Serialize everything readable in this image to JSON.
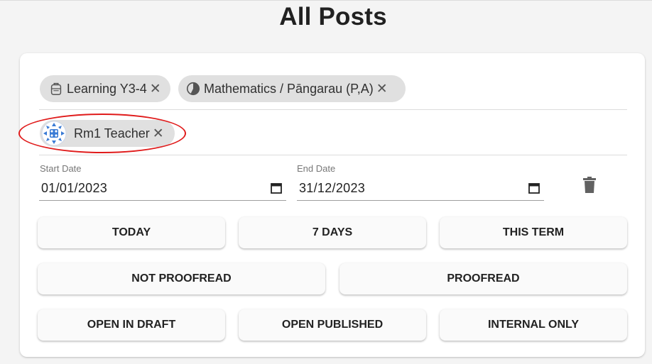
{
  "page": {
    "title": "All Posts"
  },
  "chips": {
    "group": "Learning Y3-4",
    "subject": "Mathematics / Pāngarau (P,A)",
    "teacher": "Rm1 Teacher",
    "close_glyph": "✕"
  },
  "dates": {
    "start_label": "Start Date",
    "start_value": "01/01/2023",
    "end_label": "End Date",
    "end_value": "31/12/2023"
  },
  "filters": {
    "today": "TODAY",
    "seven_days": "7 DAYS",
    "this_term": "THIS TERM",
    "not_proofread": "NOT PROOFREAD",
    "proofread": "PROOFREAD",
    "open_in_draft": "OPEN IN DRAFT",
    "open_published": "OPEN PUBLISHED",
    "internal_only": "INTERNAL ONLY"
  },
  "icons": {
    "group_chip": "backpack-icon",
    "subject_chip": "pie-chart-icon",
    "teacher_chip": "avatar-pattern-icon",
    "date": "calendar-icon",
    "clear": "trash-icon"
  },
  "colors": {
    "highlight": "#e01b1b",
    "chip_bg": "#e0e0e0",
    "avatar": "#3a7bd5"
  }
}
